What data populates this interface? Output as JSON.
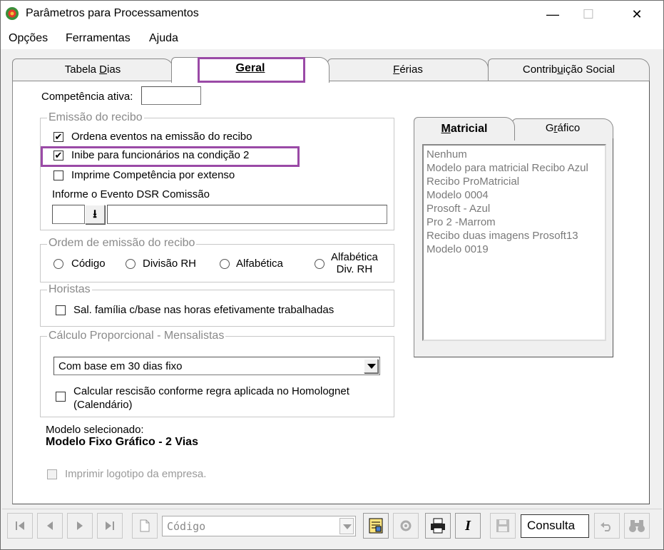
{
  "window": {
    "title": "Parâmetros para Processamentos",
    "minimize": "—",
    "maximize": "☐",
    "close": "✕"
  },
  "menu": {
    "opcoes": "Opções",
    "ferramentas": "Ferramentas",
    "ajuda": "Ajuda"
  },
  "tabs": {
    "tabela_dias_pre": "Tabela ",
    "tabela_dias_u": "D",
    "tabela_dias_post": "ias",
    "geral_u": "G",
    "geral_post": "eral",
    "ferias_u": "F",
    "ferias_post": "érias",
    "contrib_pre": "Contrib",
    "contrib_u": "u",
    "contrib_post": "ição Social"
  },
  "competencia": {
    "label": "Competência ativa:",
    "value": ""
  },
  "emissao": {
    "title": "Emissão do recibo",
    "ordena_label": "Ordena eventos na emissão do recibo",
    "ordena_mark": "✔",
    "inibe_label": "Inibe para funcionários na condição 2",
    "inibe_mark": "✔",
    "imprime_label": "Imprime Competência por extenso",
    "dsr_label": "Informe o Evento DSR Comissão",
    "dsr_code": "",
    "dsr_desc": "",
    "lookup_glyph": "⭳"
  },
  "ordem": {
    "title": "Ordem de emissão do recibo",
    "codigo": "Código",
    "divisao": "Divisão RH",
    "alfabetica": "Alfabética",
    "alfa_div_line1": "Alfabética",
    "alfa_div_line2": "Div.  RH"
  },
  "horistas": {
    "title": "Horistas",
    "sal_familia": "Sal. família c/base nas horas efetivamente trabalhadas"
  },
  "calculo": {
    "title": "Cálculo Proporcional - Mensalistas",
    "select_value": "Com base em 30 dias fixo",
    "rescisao_line1": "Calcular rescisão conforme regra aplicada no Homolognet",
    "rescisao_line2": "(Calendário)"
  },
  "modelo": {
    "label": "Modelo selecionado:",
    "value": "Modelo Fixo Gráfico - 2 Vias"
  },
  "logotipo_label": "Imprimir logotipo da empresa.",
  "right_tabs": {
    "matricial_u": "M",
    "matricial_post": "atricial",
    "grafico_pre": "G",
    "grafico_u": "r",
    "grafico_post": "áfico"
  },
  "modelos_list": [
    "Nenhum",
    "Modelo para matricial Recibo Azul",
    "Recibo ProMatricial",
    "Modelo 0004",
    "Prosoft - Azul",
    "Pro 2 -Marrom",
    "Recibo duas imagens Prosoft13",
    "Modelo 0019"
  ],
  "toolbar": {
    "codigo_placeholder": "Código",
    "consulta": "Consulta",
    "italic": "I"
  },
  "colors": {
    "highlight": "#9a4aa6",
    "panel": "#f0f0f0"
  }
}
